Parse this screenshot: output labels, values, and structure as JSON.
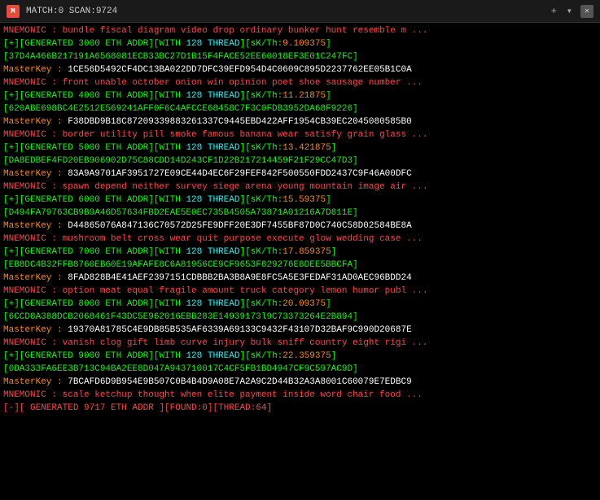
{
  "titleBar": {
    "icon": "M",
    "title": "MATCH:0 SCAN:9724",
    "close": "✕",
    "plus": "+",
    "arrow": "▾"
  },
  "lines": [
    {
      "type": "mnemonic",
      "text": "MNEMONIC : bundle fiscal diagram video drop ordinary bunker hunt resemble m ..."
    },
    {
      "type": "generated",
      "num": "3000",
      "skth": "9.109375"
    },
    {
      "type": "hash",
      "text": "37D4A466B217191A6568081ECB33BC27D1B15F4FACE52EE60018EF3E01C247FC"
    },
    {
      "type": "masterkey",
      "text": "1CE56D5492CF4DC13BA022DD7DFC39EFD954D4C0609C895D2237762EE05B1C0A"
    },
    {
      "type": "mnemonic",
      "text": "MNEMONIC : front unable october onion win opinion poet shoe sausage number ..."
    },
    {
      "type": "generated",
      "num": "4000",
      "skth": "11.21875"
    },
    {
      "type": "hash",
      "text": "620ABE698BC4E2512E569241AFF0F6C4AFCCE68458C7F3C0FDB3952DA68F9226"
    },
    {
      "type": "masterkey",
      "text": "F38DBD9B18C87209339883261337C9445EBD422AFF1954CB39EC2045080585B0"
    },
    {
      "type": "mnemonic",
      "text": "MNEMONIC : border utility pill smoke famous banana wear satisfy grain glass ..."
    },
    {
      "type": "generated",
      "num": "5000",
      "skth": "13.421875"
    },
    {
      "type": "hash",
      "text": "DA8EDBEF4FD20EB906902D75C88CDD14D243CF1D22B217214459F21F29CC47D3"
    },
    {
      "type": "masterkey",
      "text": "83A9A9701AF3951727E09CE44D4EC6F29FEF842F500550FDD2437C9F46A00DFC"
    },
    {
      "type": "mnemonic",
      "text": "MNEMONIC : spawn depend neither survey siege arena young mountain image air ..."
    },
    {
      "type": "generated",
      "num": "6000",
      "skth": "15.59375"
    },
    {
      "type": "hash",
      "text": "D494FA79763CB9B9A46D57634FBD2EAE5E0EC735B4505A73871A01216A7D811E"
    },
    {
      "type": "masterkey",
      "text": "D44865076A847136C70572D25FE9DFF20E3DF7455BF87D0C740C58D02584BE8A"
    },
    {
      "type": "mnemonic",
      "text": "MNEMONIC : mushroom belt cross wear quit purpose execute glow wedding case ..."
    },
    {
      "type": "generated",
      "num": "7000",
      "skth": "17.859375"
    },
    {
      "type": "hash",
      "text": "EB8DC4B32FFB8760EB60E19AFAFE8C6A81956CE9CF9653F829276E8DEE5BBCFA"
    },
    {
      "type": "masterkey",
      "text": "8FAD828B4E41AEF2397151CDBBB2BA3B8A9E8FC5A5E3FEDAF31AD0AEC96BDD24"
    },
    {
      "type": "mnemonic",
      "text": "MNEMONIC : option meat equal fragile amount truck category lemon humor publ ..."
    },
    {
      "type": "generated",
      "num": "8000",
      "skth": "20.09375"
    },
    {
      "type": "hash",
      "text": "6CCD8A388DCB2068461F43DC5E962016EBB283E14939173l9C73373264E2B894"
    },
    {
      "type": "masterkey",
      "text": "19370A81785C4E9DB85B535AF6339A69133C9432F43107D32BAF9C990D20687E"
    },
    {
      "type": "mnemonic",
      "text": "MNEMONIC : vanish clog gift limb curve injury bulk sniff country eight rigi ..."
    },
    {
      "type": "generated",
      "num": "9000",
      "skth": "22.359375"
    },
    {
      "type": "hash",
      "text": "0DA333FA6EE3B713C94BA2EE8D047A943710017C4CF5FB1BD4947CF9C597AC9D"
    },
    {
      "type": "masterkey",
      "text": "7BCAFD6D9B954E9B507C0B4B4D9A08E7A2A9C2D44B32A3A8001C60079E7EDBC9"
    },
    {
      "type": "mnemonic",
      "text": "MNEMONIC : scale ketchup thought when elite payment inside word chair food ..."
    },
    {
      "type": "statusbar",
      "num": "9717",
      "found": "0",
      "thread": "64"
    }
  ]
}
